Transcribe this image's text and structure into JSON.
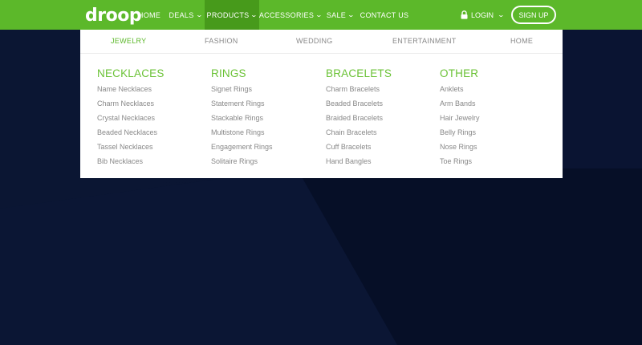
{
  "brand": {
    "logo_text": "droop",
    "accent": "#5cb82a",
    "accent_dark": "#479a1b",
    "bg": "#0a1432"
  },
  "nav": {
    "items": [
      {
        "label": "HOME",
        "dropdown": false
      },
      {
        "label": "DEALS",
        "dropdown": true
      },
      {
        "label": "PRODUCTS",
        "dropdown": true,
        "active": true
      },
      {
        "label": "ACCESSORIES",
        "dropdown": true
      },
      {
        "label": "SALE",
        "dropdown": true
      },
      {
        "label": "CONTACT US",
        "dropdown": false
      }
    ],
    "login_label": "LOGIN",
    "signup_label": "SIGN UP"
  },
  "dropdown": {
    "tabs": [
      {
        "label": "JEWELRY",
        "active": true
      },
      {
        "label": "FASHION"
      },
      {
        "label": "WEDDING"
      },
      {
        "label": "ENTERTAINMENT"
      },
      {
        "label": "HOME"
      }
    ],
    "columns": [
      {
        "title": "NECKLACES",
        "links": [
          "Name Necklaces",
          "Charm Necklaces",
          "Crystal Necklaces",
          "Beaded Necklaces",
          "Tassel Necklaces",
          "Bib Necklaces"
        ]
      },
      {
        "title": "RINGS",
        "links": [
          "Signet Rings",
          "Statement Rings",
          "Stackable Rings",
          "Multistone Rings",
          "Engagement Rings",
          "Solitaire Rings"
        ]
      },
      {
        "title": "BRACELETS",
        "links": [
          "Charm Bracelets",
          "Beaded Bracelets",
          "Braided Bracelets",
          "Chain Bracelets",
          "Cuff Bracelets",
          "Hand Bangles"
        ]
      },
      {
        "title": "OTHER",
        "links": [
          "Anklets",
          "Arm Bands",
          "Hair Jewelry",
          "Belly Rings",
          "Nose Rings",
          "Toe Rings"
        ]
      }
    ]
  },
  "icons": {
    "lock": "lock-icon",
    "chevron": "chevron-down-icon"
  }
}
